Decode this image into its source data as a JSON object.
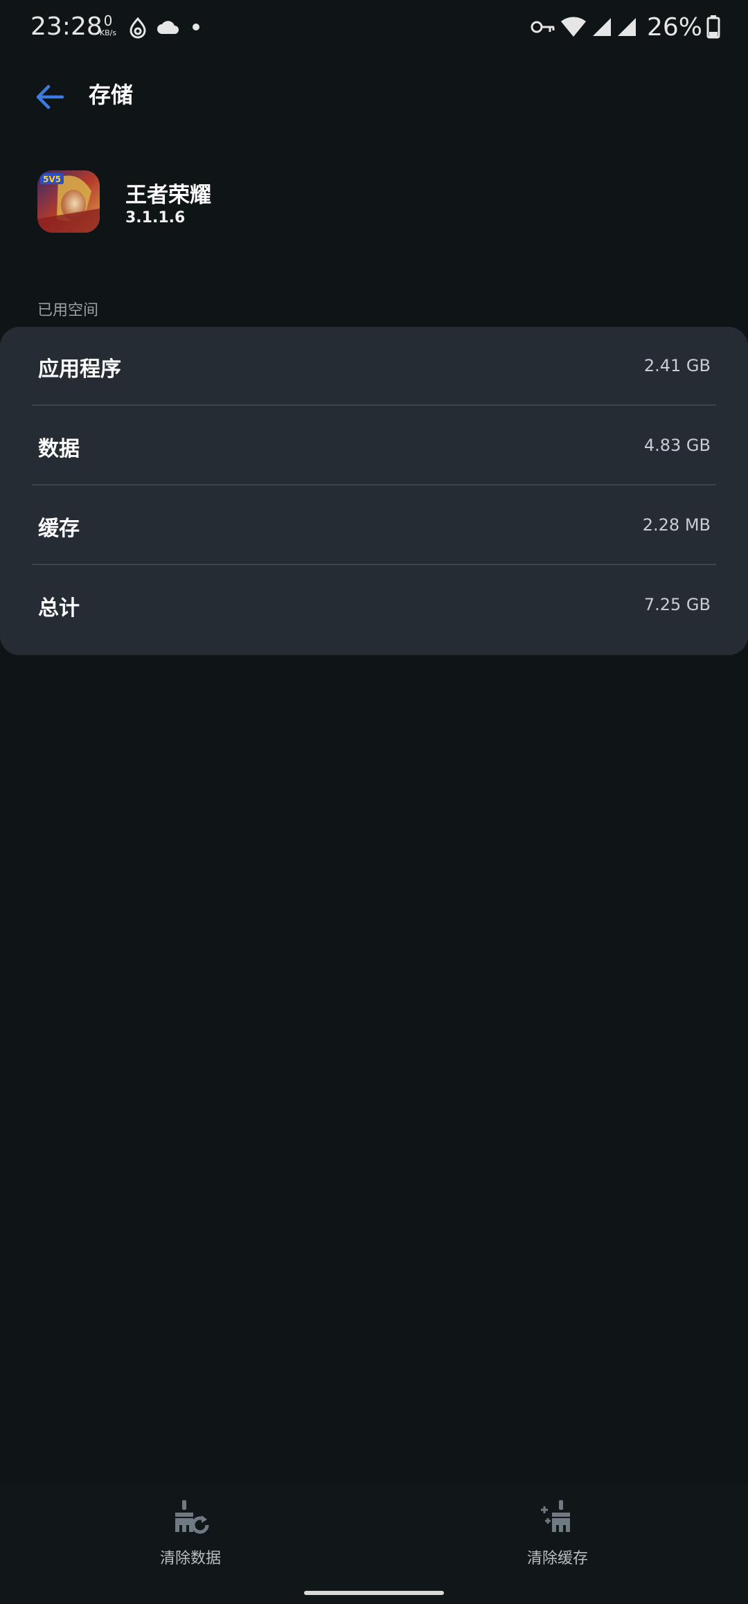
{
  "status_bar": {
    "time": "23:28",
    "net_speed_value": "0",
    "net_speed_unit": "KB/s",
    "battery": "26%",
    "icons": [
      "data-saver-icon",
      "cloud-icon",
      "dot-icon",
      "vpn-key-icon",
      "wifi-icon",
      "signal-icon",
      "signal-icon",
      "battery-icon"
    ]
  },
  "header": {
    "title": "存储",
    "back_icon": "arrow-back-icon",
    "accent_color": "#3d7be0"
  },
  "app": {
    "name": "王者荣耀",
    "version": "3.1.1.6",
    "icon": "app-icon"
  },
  "storage": {
    "section_label": "已用空间",
    "rows": [
      {
        "label": "应用程序",
        "value": "2.41 GB"
      },
      {
        "label": "数据",
        "value": "4.83 GB"
      },
      {
        "label": "缓存",
        "value": "2.28 MB"
      },
      {
        "label": "总计",
        "value": "7.25 GB"
      }
    ]
  },
  "actions": {
    "clear_data": "清除数据",
    "clear_cache": "清除缓存"
  }
}
